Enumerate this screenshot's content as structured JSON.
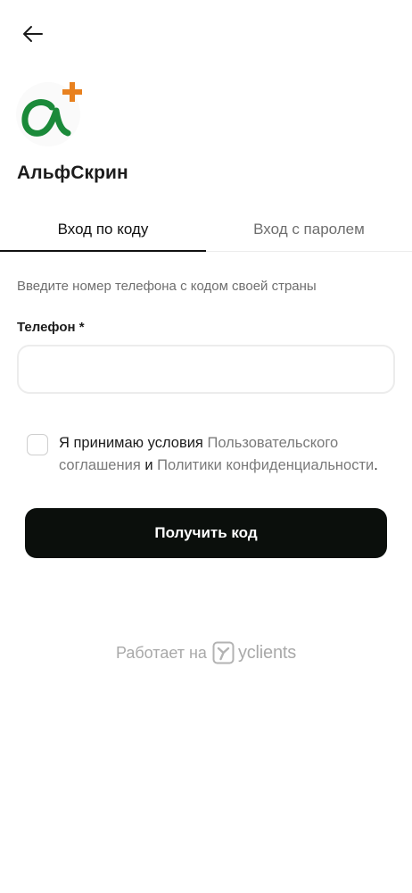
{
  "header": {
    "back_icon": "arrow-left-icon"
  },
  "company": {
    "name": "АльфСкрин",
    "logo_colors": {
      "alpha": "#1b8a3a",
      "plus": "#e8811f"
    }
  },
  "tabs": [
    {
      "label": "Вход по коду",
      "active": true
    },
    {
      "label": "Вход с паролем",
      "active": false
    }
  ],
  "form": {
    "hint": "Введите номер телефона с кодом своей страны",
    "phone_label": "Телефон *",
    "phone_value": "",
    "phone_placeholder": ""
  },
  "consent": {
    "text_before": "Я принимаю условия ",
    "link_agreement": "Пользовательского соглашения",
    "text_middle": " и ",
    "link_policy": "Политики конфиденциальности",
    "text_after": ".",
    "checked": false
  },
  "submit": {
    "label": "Получить код"
  },
  "footer": {
    "powered_by": "Работает на",
    "brand": "yclients"
  }
}
